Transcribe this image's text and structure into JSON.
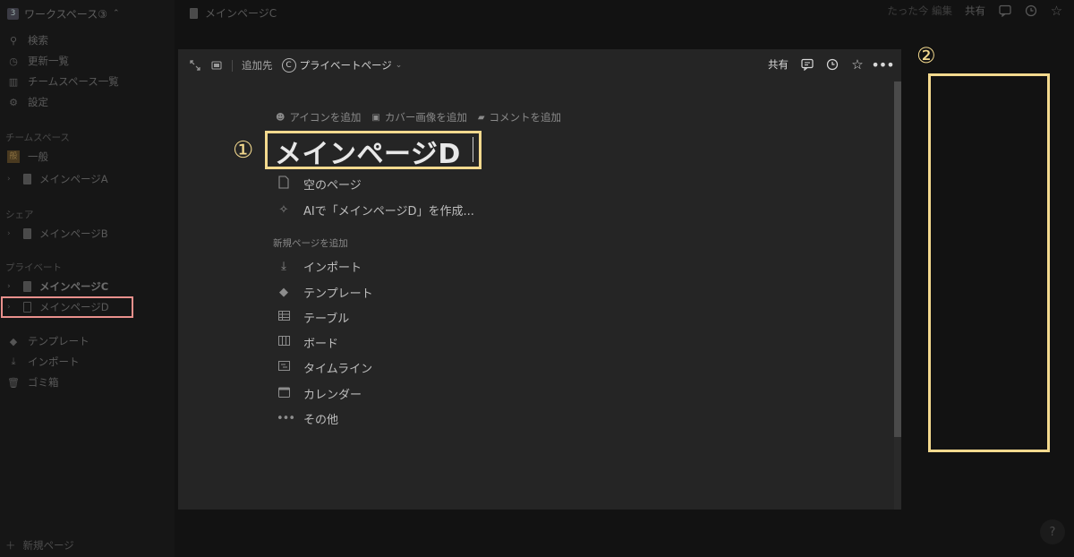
{
  "sidebar": {
    "workspace": {
      "badge": "3",
      "name": "ワークスペース③",
      "chevron": "⌃"
    },
    "top_items": [
      {
        "icon": "search-icon",
        "label": "検索"
      },
      {
        "icon": "clock-icon",
        "label": "更新一覧"
      },
      {
        "icon": "teamspaces-icon",
        "label": "チームスペース一覧"
      },
      {
        "icon": "gear-icon",
        "label": "設定"
      }
    ],
    "teamspace_section": "チームスペース",
    "teamspace_items": [
      {
        "label": "一般"
      },
      {
        "label": "メインページA"
      }
    ],
    "share_section": "シェア",
    "share_items": [
      {
        "label": "メインページB"
      }
    ],
    "private_section": "プライベート",
    "private_items": [
      {
        "label": "メインページC"
      },
      {
        "label": "メインページD"
      }
    ],
    "bottom_items": [
      {
        "icon": "template-icon",
        "label": "テンプレート"
      },
      {
        "icon": "import-icon",
        "label": "インポート"
      },
      {
        "icon": "trash-icon",
        "label": "ゴミ箱"
      }
    ],
    "new_page": "新規ページ"
  },
  "topbar": {
    "breadcrumb": "メインページC",
    "edited": "たった今 編集",
    "share": "共有"
  },
  "modal": {
    "add_to_label": "追加先",
    "destination_badge": "C",
    "destination": "プライベートページ",
    "share": "共有",
    "adders": [
      {
        "icon": "smiley-icon",
        "label": "アイコンを追加"
      },
      {
        "icon": "image-icon",
        "label": "カバー画像を追加"
      },
      {
        "icon": "comment-icon",
        "label": "コメントを追加"
      }
    ],
    "title": "メインページD",
    "options_top": [
      {
        "icon": "page-icon",
        "label": "空のページ"
      },
      {
        "icon": "sparkle-icon",
        "label": "AIで「メインページD」を作成..."
      }
    ],
    "section_label": "新規ページを追加",
    "options": [
      {
        "icon": "import-icon",
        "label": "インポート"
      },
      {
        "icon": "template-icon",
        "label": "テンプレート"
      },
      {
        "icon": "table-icon",
        "label": "テーブル"
      },
      {
        "icon": "board-icon",
        "label": "ボード"
      },
      {
        "icon": "timeline-icon",
        "label": "タイムライン"
      },
      {
        "icon": "calendar-icon",
        "label": "カレンダー"
      },
      {
        "icon": "more-icon",
        "label": "その他"
      }
    ]
  },
  "annotations": {
    "marker_1": "①",
    "marker_2": "②",
    "highlight_color": "#f3d98e",
    "sidebar_highlight_color": "#e8908c"
  },
  "help": "?"
}
